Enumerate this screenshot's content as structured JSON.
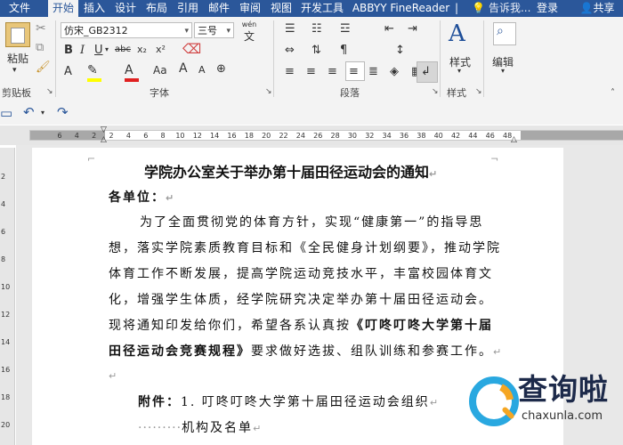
{
  "tabs": {
    "file": "文件",
    "home": "开始",
    "insert": "插入",
    "design": "设计",
    "layout": "布局",
    "references": "引用",
    "mailings": "邮件",
    "review": "审阅",
    "view": "视图",
    "developer": "开发工具",
    "abbyy": "ABBYY FineReader",
    "sep": "|",
    "tell_me": "告诉我...",
    "signin": "登录",
    "share": "共享"
  },
  "ribbon": {
    "clipboard": {
      "paste": "粘贴",
      "group": "剪贴板"
    },
    "font": {
      "font_name": "仿宋_GB2312",
      "font_size": "三号",
      "wen_glyph": "wén",
      "bold": "B",
      "italic": "I",
      "underline": "U",
      "strike": "abc",
      "sub": "x₂",
      "sup": "x²",
      "grow": "A",
      "shrink": "A",
      "aa": "Aa",
      "group": "字体"
    },
    "paragraph": {
      "group": "段落"
    },
    "styles": {
      "label": "样式",
      "group": "样式"
    },
    "editing": {
      "label": "编辑"
    }
  },
  "ruler": {
    "ticks": [
      "6",
      "4",
      "2",
      "2",
      "4",
      "6",
      "8",
      "10",
      "12",
      "14",
      "16",
      "18",
      "20",
      "22",
      "24",
      "26",
      "28",
      "30",
      "32",
      "34",
      "36",
      "38",
      "40",
      "42",
      "44",
      "46",
      "48"
    ]
  },
  "vruler": {
    "ticks": [
      "2",
      "4",
      "6",
      "8",
      "10",
      "12",
      "14",
      "16",
      "18",
      "20"
    ]
  },
  "document": {
    "title": "学院办公室关于举办第十届田径运动会的通知",
    "salutation": "各单位：",
    "lines": [
      "为了全面贯彻党的体育方针，实现“健康第一”的指导思",
      "想，落实学院素质教育目标和《全民健身计划纲要》，推动学院",
      "体育工作不断发展，提高学院运动竞技水平，丰富校园体育文",
      "化，增强学生体质，经学院研究决定举办第十届田径运动会。"
    ],
    "line5_pre": "现将通知印发给你们，希望各系认真按",
    "line5_bold": "《叮咚叮咚大学第十届",
    "line6_bold": "田径运动会竞赛规程》",
    "line6_post": "要求做好选拔、组队训练和参赛工作。",
    "attach_label": "附件：",
    "attach_text": "1. 叮咚叮咚大学第十届田径运动会组织",
    "attach_cont_dots": "·········",
    "attach_cont": "机构及名单",
    "para_mark": "↵"
  },
  "watermark": {
    "text": "查询啦",
    "domain": "chaxunla.com"
  }
}
